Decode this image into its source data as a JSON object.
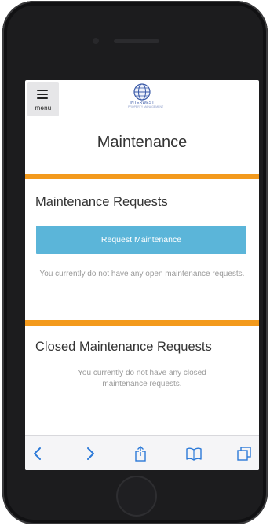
{
  "header": {
    "menu_label": "menu",
    "brand_name": "INTERWEST",
    "brand_subtitle": "PROPERTY MANAGEMENT"
  },
  "page": {
    "title": "Maintenance"
  },
  "maintenance_requests": {
    "heading": "Maintenance Requests",
    "button_label": "Request Maintenance",
    "empty_text": "You currently do not have any open maintenance requests."
  },
  "closed_requests": {
    "heading": "Closed Maintenance Requests",
    "empty_text": "You currently do not have any closed maintenance requests."
  },
  "toolbar": {
    "icons": [
      "back-icon",
      "forward-icon",
      "share-icon",
      "bookmarks-icon",
      "tabs-icon"
    ]
  },
  "colors": {
    "accent_orange": "#f39a1d",
    "button_blue": "#5bb5d9",
    "ios_blue": "#2b79d8",
    "phone_body": "#1c1c1e"
  }
}
